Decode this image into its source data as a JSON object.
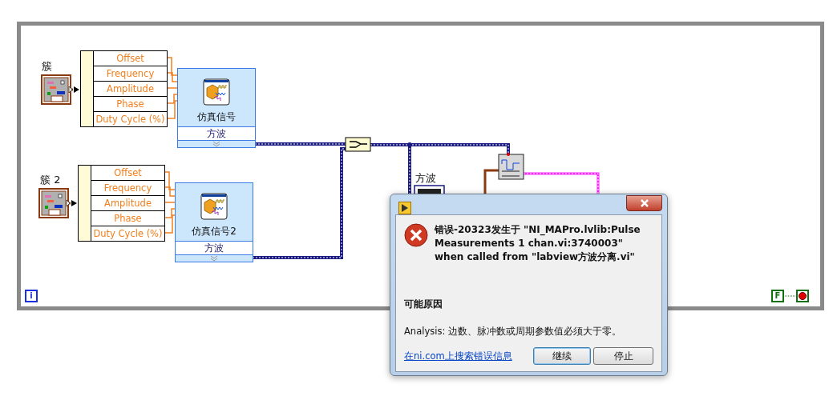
{
  "loop": {
    "iteration_terminal": "i",
    "stop_constant": "F"
  },
  "clusters": [
    {
      "label": "簇",
      "fields": [
        "Offset",
        "Frequency",
        "Amplitude",
        "Phase",
        "Duty Cycle (%)"
      ]
    },
    {
      "label": "簇 2",
      "fields": [
        "Offset",
        "Frequency",
        "Amplitude",
        "Phase",
        "Duty Cycle (%)"
      ]
    }
  ],
  "simulate_nodes": [
    {
      "title": "仿真信号",
      "output": "方波"
    },
    {
      "title": "仿真信号2",
      "output": "方波"
    }
  ],
  "indicator": {
    "label": "方波"
  },
  "dialog": {
    "message": "错误-20323发生于  \"NI_MAPro.lvlib:Pulse Measurements 1 chan.vi:3740003\" when called from \"labview方波分离.vi\"",
    "reason_heading": "可能原因",
    "reason": "Analysis:  边数、脉冲数或周期参数值必须大于零。",
    "link": "在ni.com上搜索错误信息",
    "buttons": [
      {
        "label": "继续",
        "selected": true
      },
      {
        "label": "停止",
        "selected": false
      }
    ]
  }
}
